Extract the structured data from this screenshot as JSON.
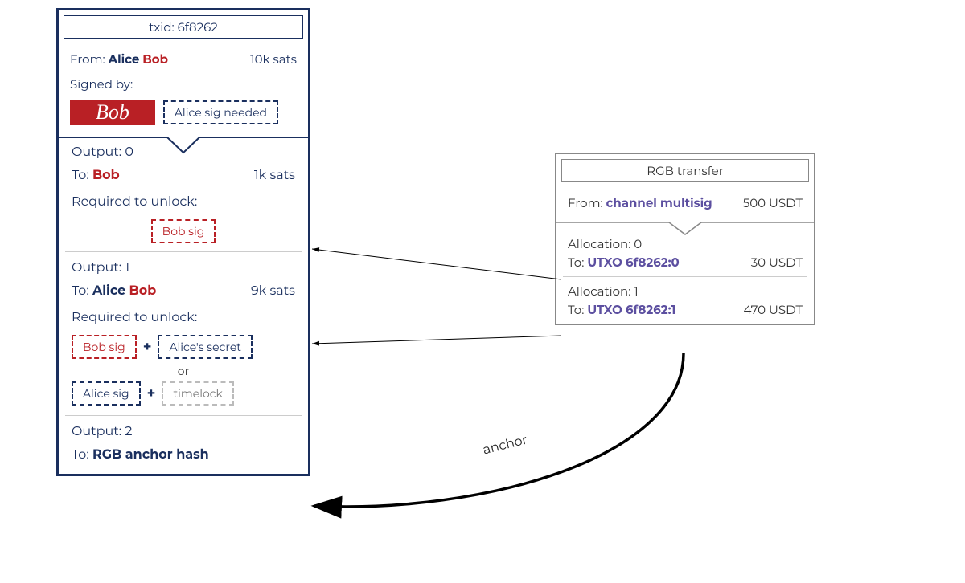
{
  "tx": {
    "txid_label": "txid: 6f8262",
    "from_label": "From:",
    "from_alice": "Alice",
    "from_bob": "Bob",
    "amount": "10k sats",
    "signed_label": "Signed by:",
    "bob_sig_badge": "Bob",
    "alice_sig_needed": "Alice sig needed",
    "outputs": [
      {
        "header": "Output: 0",
        "to_label": "To:",
        "to_name": "Bob",
        "to_name_class": "bob",
        "amount": "1k sats",
        "unlock_label": "Required to unlock:",
        "unlock_center": "Bob sig"
      },
      {
        "header": "Output: 1",
        "to_label": "To:",
        "to_alice": "Alice",
        "to_bob": "Bob",
        "amount": "9k sats",
        "unlock_label": "Required to unlock:",
        "row1_a": "Bob sig",
        "row1_b": "Alice's secret",
        "or": "or",
        "row2_a": "Alice sig",
        "row2_b": "timelock"
      },
      {
        "header": "Output: 2",
        "to_label": "To:",
        "to_text": "RGB anchor hash"
      }
    ]
  },
  "rgb": {
    "title": "RGB transfer",
    "from_label": "From:",
    "from_name": "channel multisig",
    "amount": "500 USDT",
    "allocations": [
      {
        "header": "Allocation: 0",
        "to_label": "To:",
        "utxo": "UTXO 6f8262:0",
        "amount": "30 USDT"
      },
      {
        "header": "Allocation: 1",
        "to_label": "To:",
        "utxo": "UTXO 6f8262:1",
        "amount": "470 USDT"
      }
    ]
  },
  "anchor_label": "anchor"
}
